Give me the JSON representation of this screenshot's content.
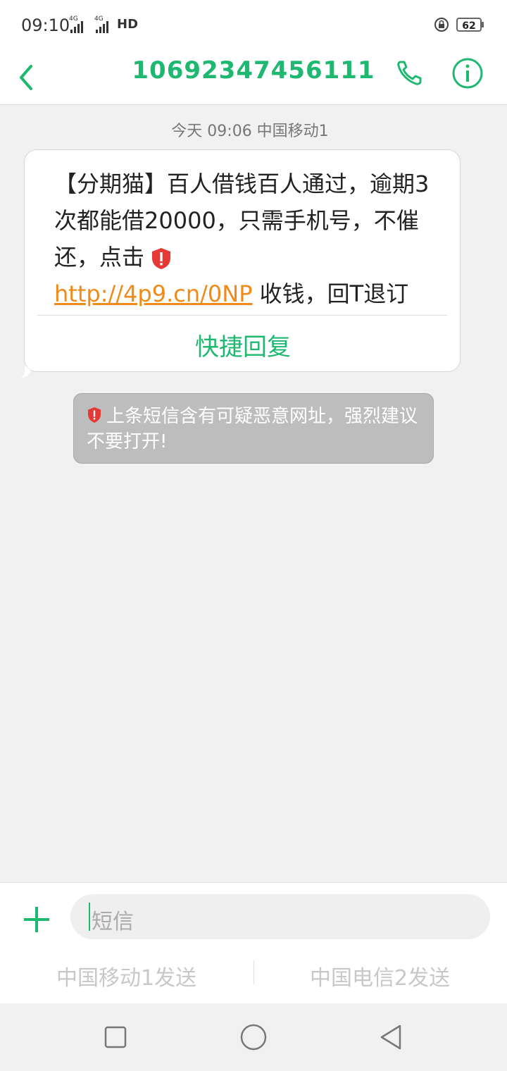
{
  "status_bar": {
    "time": "09:10",
    "sig1": "4G",
    "sig2": "4G",
    "hd": "HD",
    "battery": "62"
  },
  "header": {
    "title": "10692347456111"
  },
  "conversation": {
    "timestamp": "今天 09:06  中国移动1",
    "message": {
      "text_before_link": "【分期猫】百人借钱百人通过，逾期3次都能借20000，只需手机号，不催还，点击",
      "link": "http://4p9.cn/0NP",
      "text_after_link": " 收钱，回T退订",
      "quick_reply": "快捷回复"
    },
    "warning": "上条短信含有可疑恶意网址，强烈建议不要打开!"
  },
  "composer": {
    "placeholder": "短信",
    "send_sim1": "中国移动1发送",
    "send_sim2": "中国电信2发送"
  },
  "colors": {
    "accent": "#1fb870",
    "link": "#f08a18",
    "danger": "#e53935",
    "warning_bg": "#bdbdbd"
  }
}
